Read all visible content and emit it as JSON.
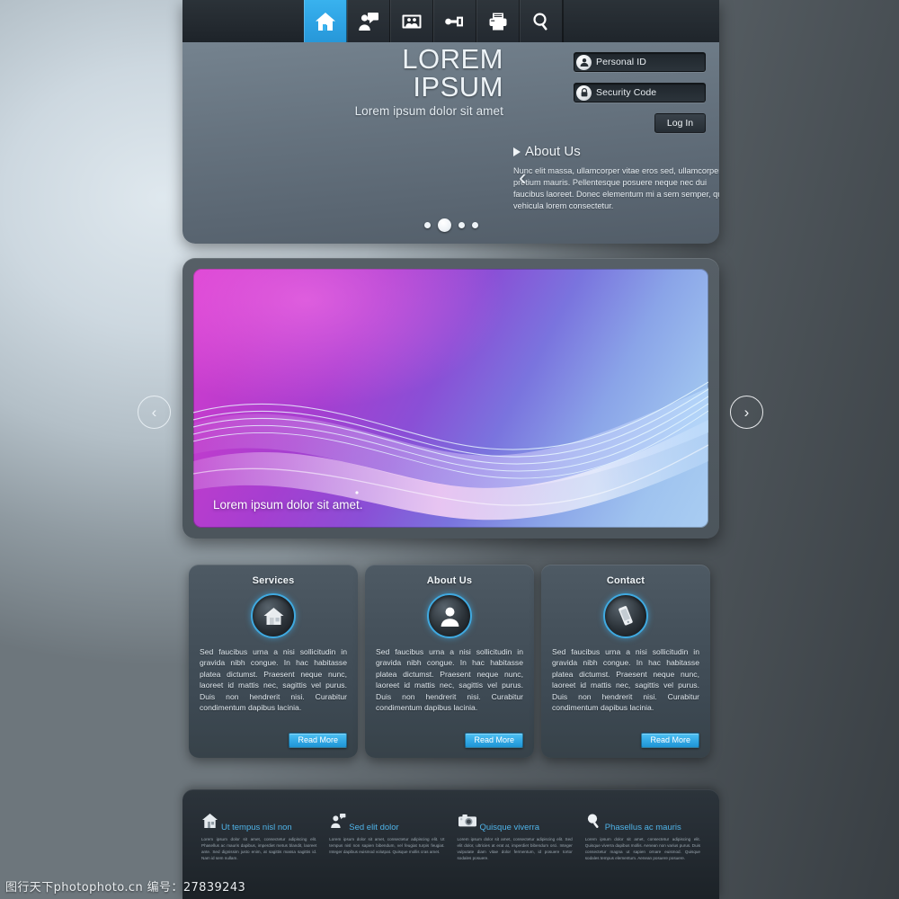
{
  "toolbar": {
    "items": [
      {
        "name": "home-icon",
        "label": "Home",
        "active": true
      },
      {
        "name": "chat-icon",
        "label": "Chat",
        "active": false
      },
      {
        "name": "gallery-icon",
        "label": "Gallery",
        "active": false
      },
      {
        "name": "key-icon",
        "label": "Access",
        "active": false
      },
      {
        "name": "printer-icon",
        "label": "Print",
        "active": false
      },
      {
        "name": "search-icon",
        "label": "Search",
        "active": false
      }
    ]
  },
  "brand": {
    "line1": "LOREM",
    "line2": "IPSUM",
    "tagline": "Lorem ipsum dolor sit amet"
  },
  "login": {
    "personal_id_placeholder": "Personal ID",
    "personal_id_value": "",
    "security_code_placeholder": "Security Code",
    "security_code_value": "",
    "login_label": "Log In"
  },
  "about_slider": {
    "heading": "About Us",
    "body": "Nunc elit massa, ullamcorper vitae eros sed, ullamcorper pretium mauris. Pellentesque posuere neque nec dui faucibus laoreet. Donec elementum mi a sem semper, quis vehicula lorem consectetur.",
    "prev": "‹",
    "next": "›",
    "dots": 4,
    "active_dot": 2
  },
  "hero": {
    "caption": "Lorem ipsum dolor sit amet.",
    "prev": "‹",
    "next": "›",
    "colors": {
      "start": "#d93fd2",
      "mid": "#8a4fd6",
      "end": "#a9cdf2"
    }
  },
  "cards": [
    {
      "title": "Services",
      "icon": "house-icon",
      "body": "Sed faucibus urna a nisi sollicitudin in gravida nibh congue. In hac habitasse platea dictumst. Praesent neque nunc, laoreet id mattis nec, sagittis vel purus. Duis non hendrerit nisi. Curabitur condimentum dapibus lacinia.",
      "button": "Read More"
    },
    {
      "title": "About Us",
      "icon": "person-icon",
      "body": "Sed faucibus urna a nisi sollicitudin in gravida nibh congue. In hac habitasse platea dictumst. Praesent neque nunc, laoreet id mattis nec, sagittis vel purus. Duis non hendrerit nisi. Curabitur condimentum dapibus lacinia.",
      "button": "Read More"
    },
    {
      "title": "Contact",
      "icon": "phone-icon",
      "body": "Sed faucibus urna a nisi sollicitudin in gravida nibh congue. In hac habitasse platea dictumst. Praesent neque nunc, laoreet id mattis nec, sagittis vel purus. Duis non hendrerit nisi. Curabitur condimentum dapibus lacinia.",
      "button": "Read More"
    }
  ],
  "footer": {
    "items": [
      {
        "icon": "house-icon",
        "title": "Ut tempus nisl non",
        "body": "Lorem ipsum dolor sit amet, consectetur adipiscing elit. Phasellus ac mauris dapibus, imperdiet metus blandit, laoreet ante. Sed dignissim justo enim, at sagittis massa sagittis id. Nam id sem nullam."
      },
      {
        "icon": "chat-icon",
        "title": "Sed elit dolor",
        "body": "Lorem ipsum dolor sit amet, consectetur adipiscing elit. Ut tempus nisl non sapien bibendum, vel feugiat turpis feugiat. Integer dapibus euismod volutpat. Quisque mollis cras amet."
      },
      {
        "icon": "camera-icon",
        "title": "Quisque viverra",
        "body": "Lorem ipsum dolor sit amet, consectetur adipiscing elit. Sed elit dolor, ultricies at erat at, imperdiet bibendum orci. Integer vulputate diam vitae dolor fermentum, id posuere tortor sodales posuere."
      },
      {
        "icon": "search-icon",
        "title": "Phasellus ac mauris",
        "body": "Lorem ipsum dolor sit amet, consectetur adipiscing elit. Quisque viverra dapibus mollis. Aenean non varius purus. Duis consectetur magna ut sapien ornare euismod. Quisque sodales tempus elementum. Aenean posuere posuere."
      }
    ]
  },
  "watermark": "图行天下photophoto.cn  编号：27839243"
}
